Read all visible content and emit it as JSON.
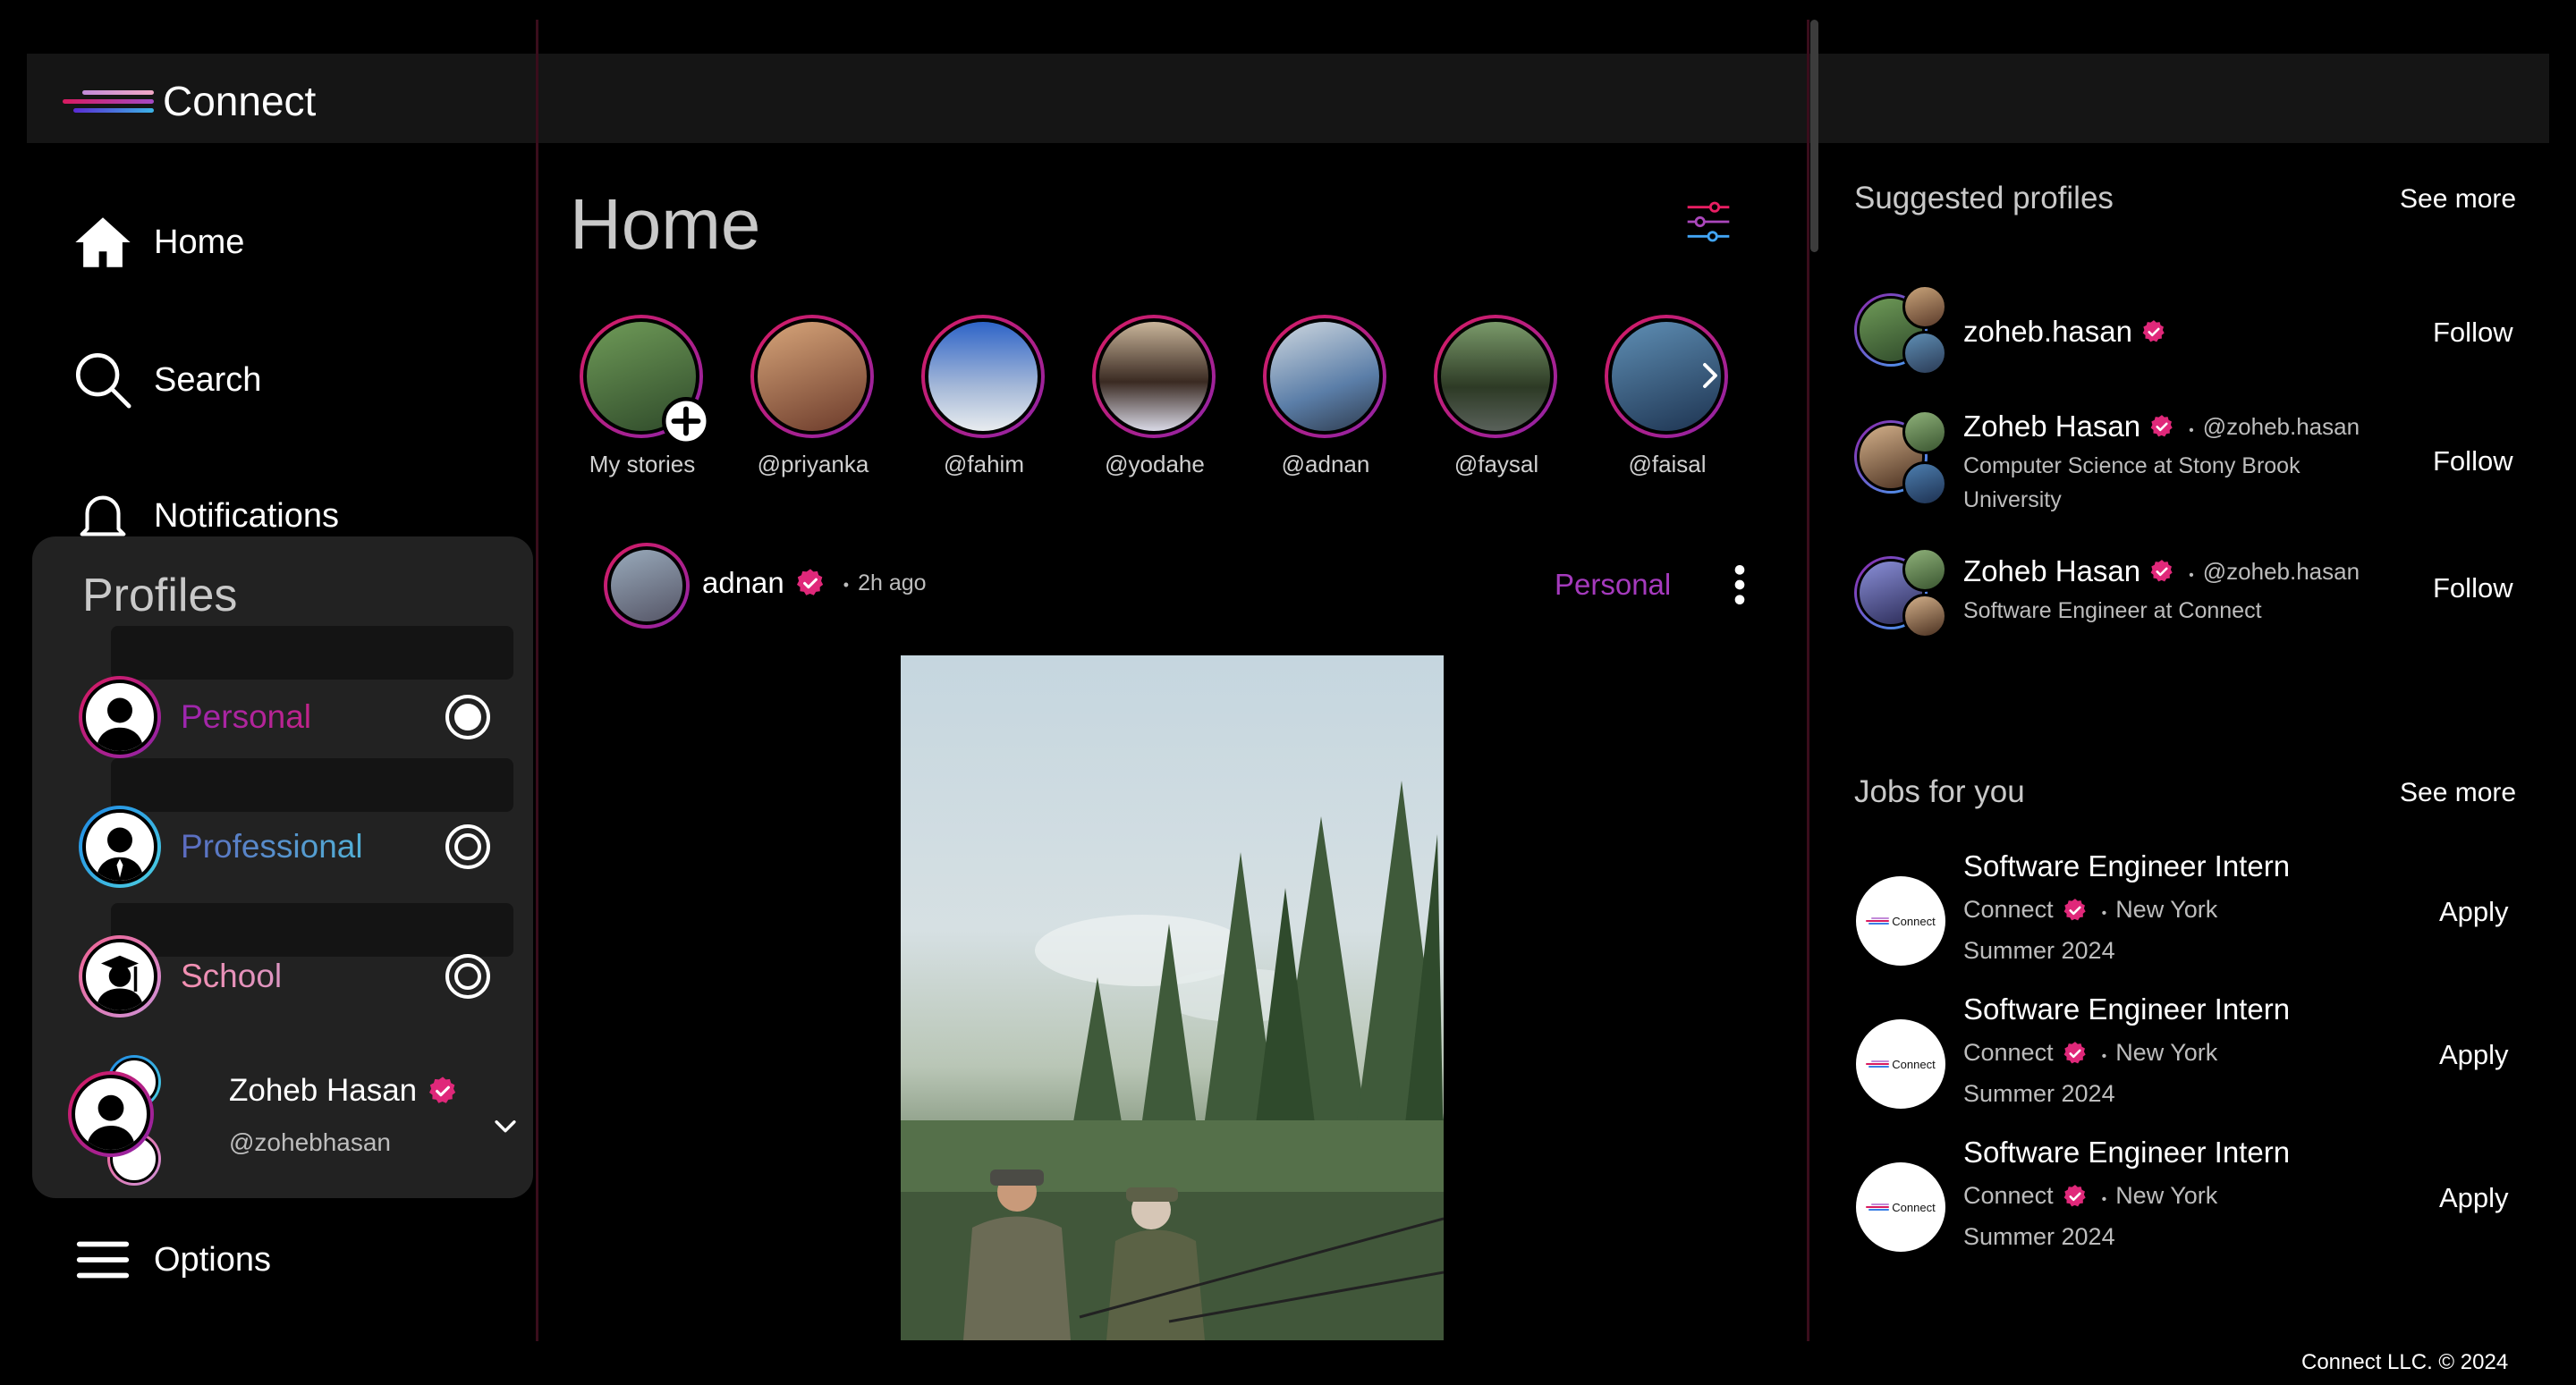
{
  "app": {
    "name": "Connect"
  },
  "nav": {
    "home": "Home",
    "search": "Search",
    "notifications": "Notifications",
    "options": "Options"
  },
  "profiles_menu": {
    "title": "Profiles",
    "items": [
      {
        "label": "Personal",
        "selected": true,
        "color": "#c2185b"
      },
      {
        "label": "Professional",
        "selected": false,
        "color": "#5c8de0"
      },
      {
        "label": "School",
        "selected": false,
        "color": "#d88fc9"
      }
    ],
    "user": {
      "name": "Zoheb Hasan",
      "handle": "@zohebhasan"
    }
  },
  "main": {
    "title": "Home",
    "stories": [
      {
        "handle": "My stories"
      },
      {
        "handle": "@priyanka"
      },
      {
        "handle": "@fahim"
      },
      {
        "handle": "@yodahe"
      },
      {
        "handle": "@adnan"
      },
      {
        "handle": "@faysal"
      },
      {
        "handle": "@faisal"
      }
    ],
    "post": {
      "user": "adnan",
      "time": "2h ago",
      "profile": "Personal"
    }
  },
  "suggested": {
    "title": "Suggested profiles",
    "see_more": "See more",
    "items": [
      {
        "name": "zoheb.hasan",
        "handle": "",
        "sub": "",
        "action": "Follow"
      },
      {
        "name": "Zoheb Hasan",
        "handle": "@zoheb.hasan",
        "sub": "Computer Science at Stony Brook University",
        "action": "Follow"
      },
      {
        "name": "Zoheb Hasan",
        "handle": "@zoheb.hasan",
        "sub": "Software Engineer at Connect",
        "action": "Follow"
      }
    ]
  },
  "jobs": {
    "title": "Jobs for you",
    "see_more": "See more",
    "logo_text": "Connect",
    "items": [
      {
        "title": "Software Engineer Intern",
        "company": "Connect",
        "location": "New York",
        "term": "Summer 2024",
        "action": "Apply"
      },
      {
        "title": "Software Engineer Intern",
        "company": "Connect",
        "location": "New York",
        "term": "Summer 2024",
        "action": "Apply"
      },
      {
        "title": "Software Engineer Intern",
        "company": "Connect",
        "location": "New York",
        "term": "Summer 2024",
        "action": "Apply"
      }
    ]
  },
  "footer": {
    "text": "Connect LLC. © 2024"
  },
  "colors": {
    "accent_pink": "#d81b60",
    "accent_purple": "#8e24aa",
    "badge": "#e0287a"
  }
}
